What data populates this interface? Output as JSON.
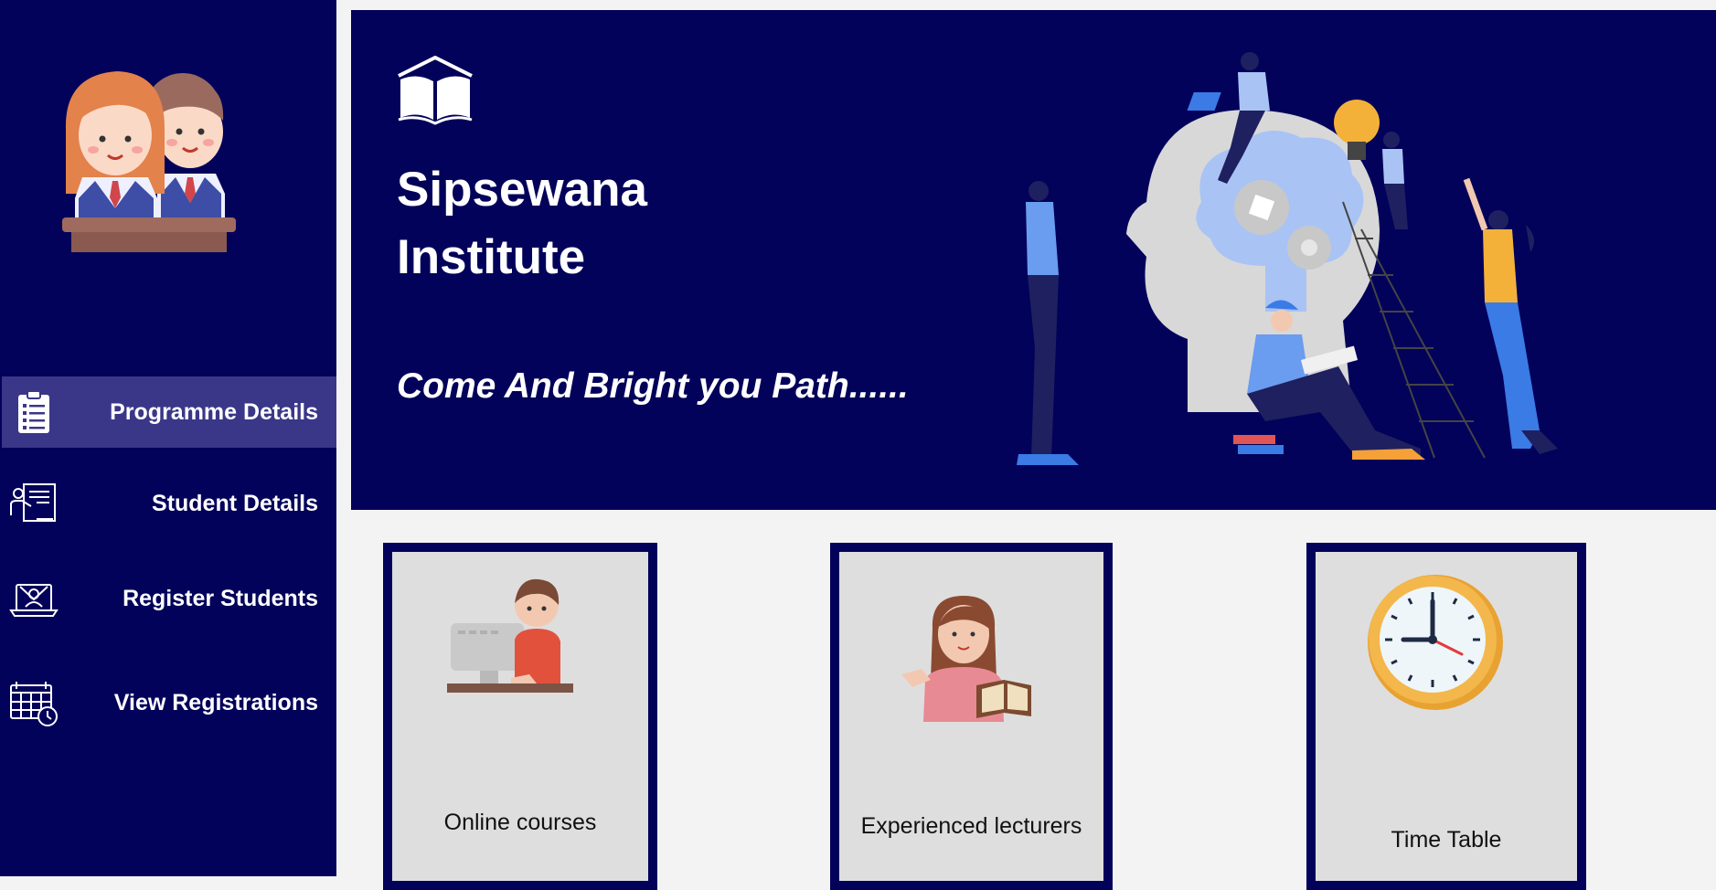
{
  "sidebar": {
    "logo_icon": "students-at-desk-icon",
    "items": [
      {
        "label": "Programme Details",
        "icon": "clipboard-list-icon",
        "active": true
      },
      {
        "label": "Student Details",
        "icon": "teacher-board-icon",
        "active": false
      },
      {
        "label": "Register Students",
        "icon": "laptop-register-icon",
        "active": false
      },
      {
        "label": "View Registrations",
        "icon": "calendar-clock-icon",
        "active": false
      }
    ]
  },
  "hero": {
    "icon": "open-book-icon",
    "title_line1": "Sipsewana",
    "title_line2": "Institute",
    "tagline": "Come And Bright you Path......",
    "illustration": "brain-teamwork-illustration"
  },
  "cards": [
    {
      "label": "Online courses",
      "icon": "person-at-computer-icon"
    },
    {
      "label": "Experienced lecturers",
      "icon": "lecturer-with-book-icon"
    },
    {
      "label": "Time Table",
      "icon": "clock-icon"
    }
  ],
  "colors": {
    "navy": "#03025a",
    "active_nav": "#3a3788",
    "card_bg": "#dedede",
    "page_bg": "#f3f3f3"
  }
}
